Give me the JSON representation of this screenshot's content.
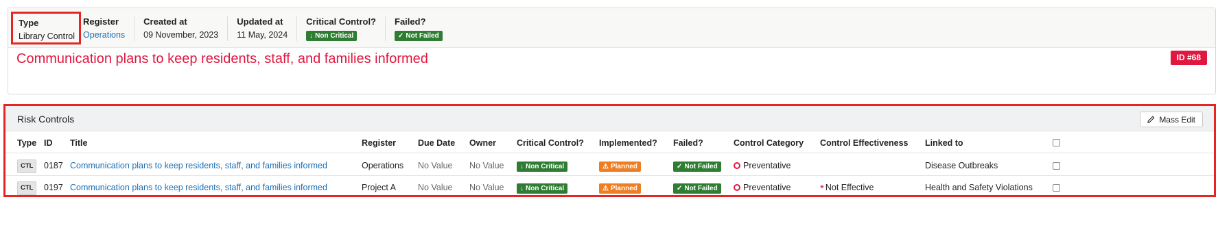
{
  "record": {
    "type_label": "Type",
    "type_value": "Library Control",
    "register_label": "Register",
    "register_value": "Operations",
    "created_label": "Created at",
    "created_value": "09 November, 2023",
    "updated_label": "Updated at",
    "updated_value": "11 May, 2024",
    "critical_label": "Critical Control?",
    "critical_value": "Non Critical",
    "failed_label": "Failed?",
    "failed_value": "Not Failed",
    "title": "Communication plans to keep residents, staff, and families informed",
    "id_badge": "ID #68"
  },
  "risk_controls": {
    "title": "Risk Controls",
    "mass_edit_label": "Mass Edit",
    "columns": {
      "type": "Type",
      "id": "ID",
      "title": "Title",
      "register": "Register",
      "due_date": "Due Date",
      "owner": "Owner",
      "critical": "Critical Control?",
      "implemented": "Implemented?",
      "failed": "Failed?",
      "category": "Control Category",
      "effectiveness": "Control Effectiveness",
      "linked_to": "Linked to"
    },
    "rows": [
      {
        "type": "CTL",
        "id": "0187",
        "title": "Communication plans to keep residents, staff, and families informed",
        "register": "Operations",
        "due_date": "No Value",
        "owner": "No Value",
        "critical": "Non Critical",
        "implemented": "Planned",
        "failed": "Not Failed",
        "category": "Preventative",
        "effectiveness": "",
        "linked_to": "Disease Outbreaks"
      },
      {
        "type": "CTL",
        "id": "0197",
        "title": "Communication plans to keep residents, staff, and families informed",
        "register": "Project A",
        "due_date": "No Value",
        "owner": "No Value",
        "critical": "Non Critical",
        "implemented": "Planned",
        "failed": "Not Failed",
        "category": "Preventative",
        "effectiveness": "Not Effective",
        "linked_to": "Health and Safety Violations"
      }
    ]
  },
  "colors": {
    "accent_red": "#e0173f",
    "highlight_red": "#e52521",
    "link_blue": "#1a6fb5",
    "badge_green": "#2e7d32",
    "badge_orange": "#ef7d22"
  },
  "icons": [
    "arrow-down-icon",
    "check-icon",
    "warning-icon",
    "pencil-icon",
    "preventative-ring-icon",
    "asterisk-icon"
  ]
}
